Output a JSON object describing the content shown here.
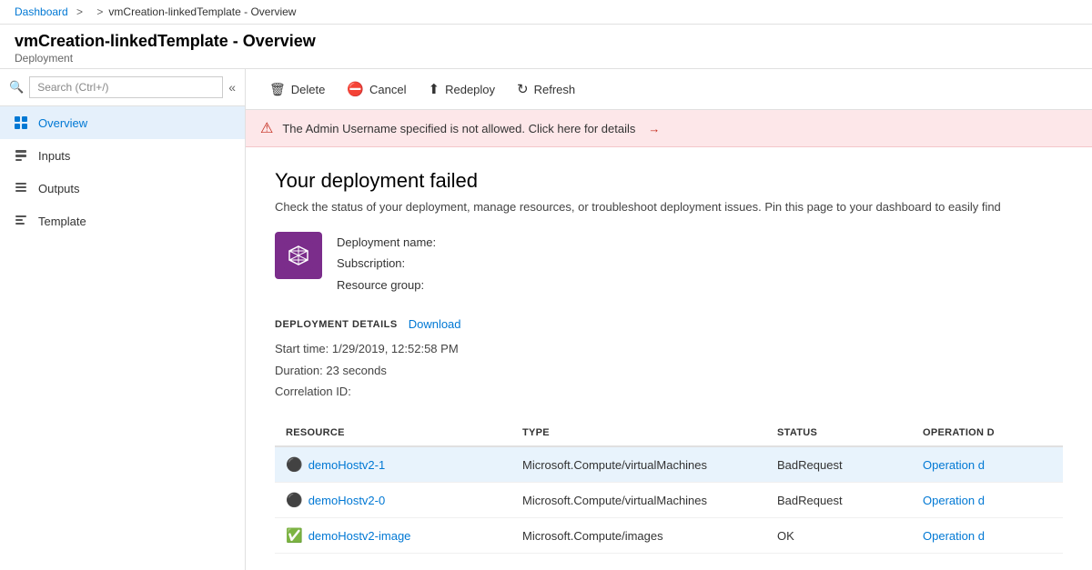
{
  "breadcrumb": {
    "home": "Dashboard",
    "separator": ">",
    "current": "vmCreation-linkedTemplate - Overview"
  },
  "page": {
    "title": "vmCreation-linkedTemplate - Overview",
    "subtitle": "Deployment"
  },
  "toolbar": {
    "delete_label": "Delete",
    "cancel_label": "Cancel",
    "redeploy_label": "Redeploy",
    "refresh_label": "Refresh"
  },
  "error_banner": {
    "message": "The Admin Username specified is not allowed. Click here for details",
    "arrow": "→"
  },
  "deployment": {
    "title": "Your deployment failed",
    "description": "Check the status of your deployment, manage resources, or troubleshoot deployment issues. Pin this page to your dashboard to easily find",
    "name_label": "Deployment name:",
    "subscription_label": "Subscription:",
    "resource_group_label": "Resource group:",
    "details_section_label": "DEPLOYMENT DETAILS",
    "download_label": "Download",
    "start_time_label": "Start time:",
    "start_time_value": "1/29/2019, 12:52:58 PM",
    "duration_label": "Duration:",
    "duration_value": "23 seconds",
    "correlation_label": "Correlation ID:"
  },
  "table": {
    "headers": [
      "RESOURCE",
      "TYPE",
      "STATUS",
      "OPERATION D"
    ],
    "rows": [
      {
        "icon": "error",
        "resource": "demoHostv2-1",
        "type": "Microsoft.Compute/virtualMachines",
        "status": "BadRequest",
        "operation": "Operation d",
        "selected": true
      },
      {
        "icon": "error",
        "resource": "demoHostv2-0",
        "type": "Microsoft.Compute/virtualMachines",
        "status": "BadRequest",
        "operation": "Operation d",
        "selected": false
      },
      {
        "icon": "success",
        "resource": "demoHostv2-image",
        "type": "Microsoft.Compute/images",
        "status": "OK",
        "operation": "Operation d",
        "selected": false
      }
    ]
  },
  "sidebar": {
    "search_placeholder": "Search (Ctrl+/)",
    "items": [
      {
        "label": "Overview",
        "icon": "overview",
        "active": true
      },
      {
        "label": "Inputs",
        "icon": "inputs",
        "active": false
      },
      {
        "label": "Outputs",
        "icon": "outputs",
        "active": false
      },
      {
        "label": "Template",
        "icon": "template",
        "active": false
      }
    ]
  }
}
